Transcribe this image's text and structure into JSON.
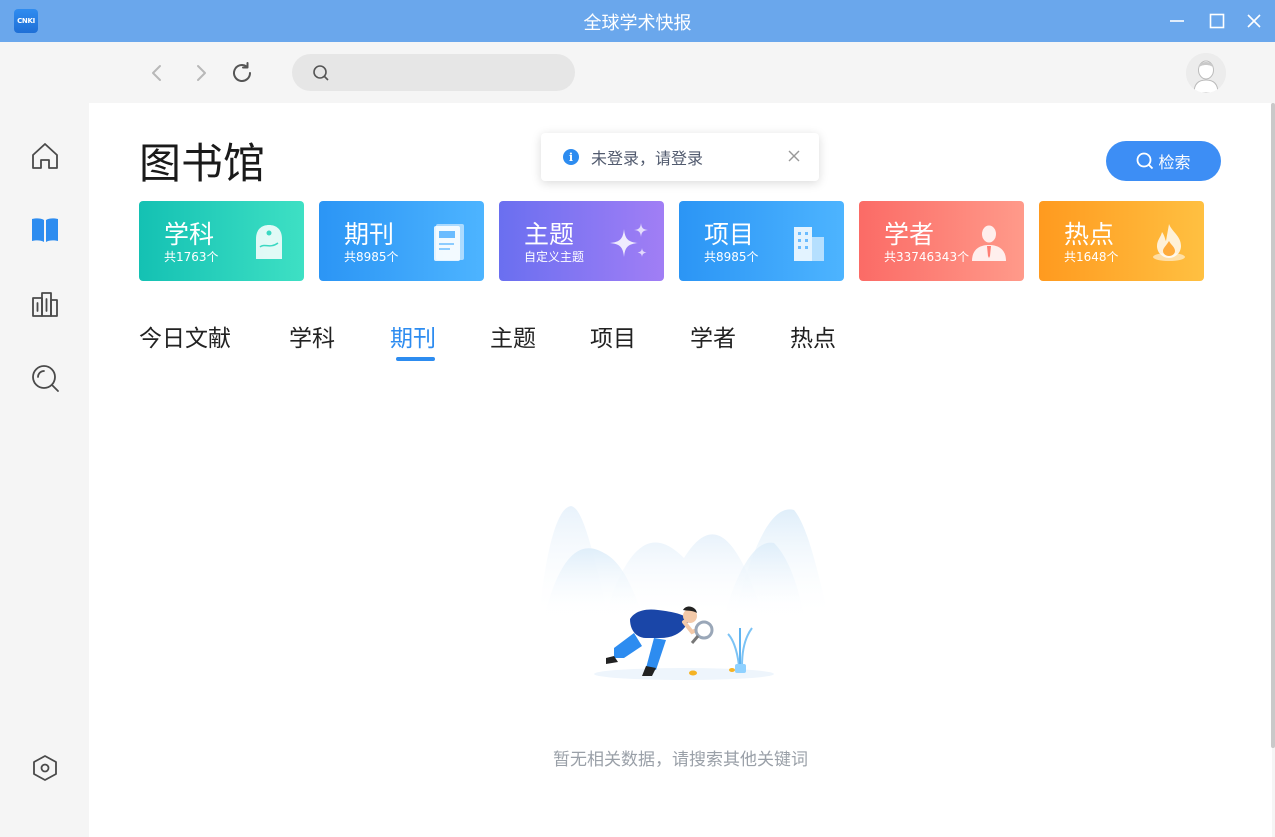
{
  "window": {
    "logo_text": "CNKI",
    "title": "全球学术快报"
  },
  "toolbar": {
    "search_placeholder": "",
    "search_value": ""
  },
  "main": {
    "page_title": "图书馆",
    "toast": {
      "message": "未登录，请登录"
    },
    "search_button_label": "检索",
    "cards": [
      {
        "title": "学科",
        "subtitle": "共1763个",
        "icon": "subject-tag-icon",
        "gradient": [
          "#14c1b3",
          "#3ee0c4"
        ]
      },
      {
        "title": "期刊",
        "subtitle": "共8985个",
        "icon": "journal-book-icon",
        "gradient": [
          "#2b95f5",
          "#4db4ff"
        ]
      },
      {
        "title": "主题",
        "subtitle": "自定义主题",
        "icon": "sparkle-icon",
        "gradient": [
          "#6a6ff0",
          "#a17ef5"
        ]
      },
      {
        "title": "项目",
        "subtitle": "共8985个",
        "icon": "building-icon",
        "gradient": [
          "#2b95f5",
          "#4db4ff"
        ]
      },
      {
        "title": "学者",
        "subtitle": "共33746343个",
        "icon": "scholar-person-icon",
        "gradient": [
          "#fb6b66",
          "#ff9a8a"
        ]
      },
      {
        "title": "热点",
        "subtitle": "共1648个",
        "icon": "flame-icon",
        "gradient": [
          "#ff9a1f",
          "#ffc041"
        ]
      }
    ],
    "tabs": [
      "今日文献",
      "学科",
      "期刊",
      "主题",
      "项目",
      "学者",
      "热点"
    ],
    "active_tab": "期刊",
    "empty_message": "暂无相关数据，请搜索其他关键词"
  },
  "colors": {
    "title_bar": "#6aa7ec",
    "accent": "#2d8cf0",
    "search_button": "#3d8ef5"
  }
}
